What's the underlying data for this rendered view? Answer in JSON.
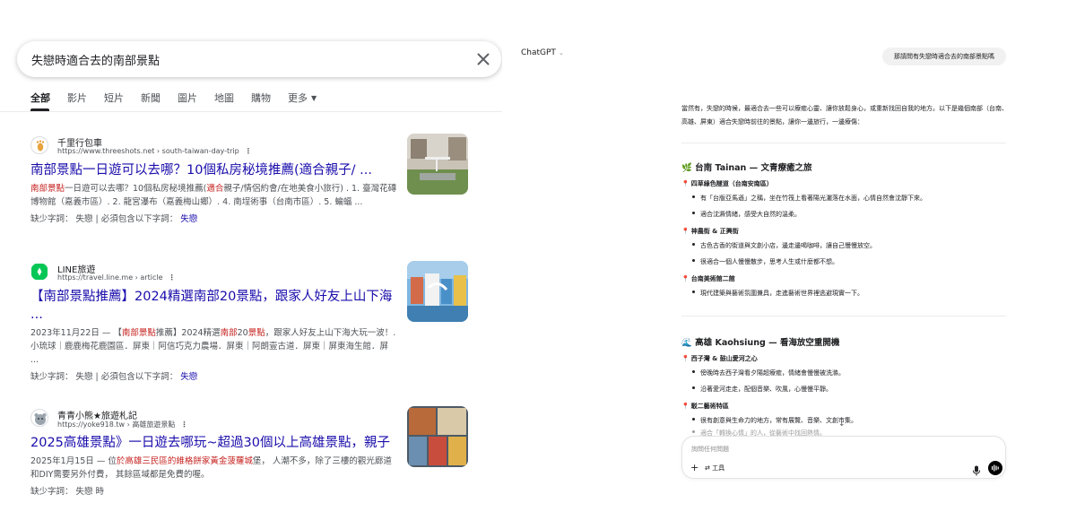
{
  "search": {
    "query": "失戀時適合去的南部景點",
    "tabs": [
      "全部",
      "影片",
      "短片",
      "新聞",
      "圖片",
      "地圖",
      "購物",
      "更多"
    ]
  },
  "results": [
    {
      "site": "千里行包車",
      "url": "https://www.threeshots.net › south-taiwan-day-trip",
      "title": "南部景點一日遊可以去哪？10個私房秘境推薦(適合親子/ ...",
      "snippet_hl": "南部景點",
      "snippet_mid": "一日遊可以去哪？10個私房秘境推薦(",
      "snippet_hl2": "適合",
      "snippet_rest": "親子/情侶約會/在地美食小旅行) . 1. 臺灣花磚博物館（嘉義市區）. 2. 龍宮瀑布（嘉義梅山鄉）. 4. 南埕術事（台南市區）. 5. 蝙蝠 ...",
      "missing_label": "缺少字詞： 失戀 | 必須包含以下字詞：",
      "missing_word": "失戀"
    },
    {
      "site": "LINE旅遊",
      "url": "https://travel.line.me › article",
      "title": "【南部景點推薦】2024精選南部20景點，跟家人好友上山下海 ...",
      "snippet_pre": "2023年11月22日 — 【",
      "snippet_hl": "南部景點",
      "snippet_mid": "推薦】2024精選",
      "snippet_hl2": "南部",
      "snippet_mid2": "20",
      "snippet_hl3": "景點",
      "snippet_rest": "，跟家人好友上山下海大玩一波！. 小琉球｜鹿鹿梅花鹿園區．屏東｜阿信巧克力農場．屏東｜阿朗壹古道．屏東｜屏東海生館．屏 ...",
      "missing_label": "缺少字詞： 失戀 | 必須包含以下字詞：",
      "missing_word": "失戀"
    },
    {
      "site": "青青小熊★旅遊札記",
      "url": "https://yoke918.tw › 高雄旅遊景點",
      "title": "2025高雄景點》一日遊去哪玩~超過30個以上高雄景點，親子",
      "snippet_pre": "2025年1月15日 — 位",
      "snippet_hl": "於高雄三民區的維格餅家黃金菠蘿城",
      "snippet_rest": "堡， 人潮不多，除了三樓的觀光廊道和DIY需要另外付費， 其餘區域都是免費的喔。",
      "missing_label": "缺少字詞： 失戀 時"
    }
  ],
  "chat": {
    "model": "ChatGPT",
    "user_message": "那請問有失戀時適合去的南部景點嗎",
    "intro": "當然有，失戀的時候，最適合去一些可以療癒心靈、讓你放鬆身心，或重新找回自我的地方。以下是幾個南部（台南、高雄、屏東）適合失戀時前往的景點，讓你一邊旅行，一邊療傷：",
    "sections": [
      {
        "emoji": "🌿",
        "heading": "台南 Tainan — 文青療癒之旅",
        "subs": [
          {
            "title": "四草綠色隧道（台南安南區）",
            "bullets": [
              "有「台版亞馬遜」之稱，坐在竹筏上看著陽光灑落在水面，心情自然會沈靜下來。",
              "適合沈澱情緒，感受大自然的溫柔。"
            ]
          },
          {
            "title": "神農街 & 正興街",
            "bullets": [
              "古色古香的街道與文創小店，邊走邊喝咖啡，讓自己慢慢放空。",
              "很適合一個人慢慢散步，思考人生或什麼都不想。"
            ]
          },
          {
            "title": "台南美術館二館",
            "bullets": [
              "現代建築與藝術氛圍兼具，走進藝術世界裡逃避現實一下。"
            ]
          }
        ]
      },
      {
        "emoji": "🌊",
        "heading": "高雄 Kaohsiung — 看海放空重開機",
        "subs": [
          {
            "title": "西子灣 & 鼓山愛河之心",
            "bullets": [
              "傍晚時去西子灣看夕陽超療癒，情緒會慢慢被洗滌。",
              "沿著愛河走走，配個音樂、吹風，心慢慢平靜。"
            ]
          },
          {
            "title": "駁二藝術特區",
            "bullets": [
              "很有創意與生命力的地方，常有展覽、音樂、文創市集。",
              "適合「轉換心情」的人，從藝術中找回熱情。"
            ]
          }
        ]
      }
    ],
    "composer_placeholder": "詢問任何問題",
    "tools_label": "工具"
  }
}
